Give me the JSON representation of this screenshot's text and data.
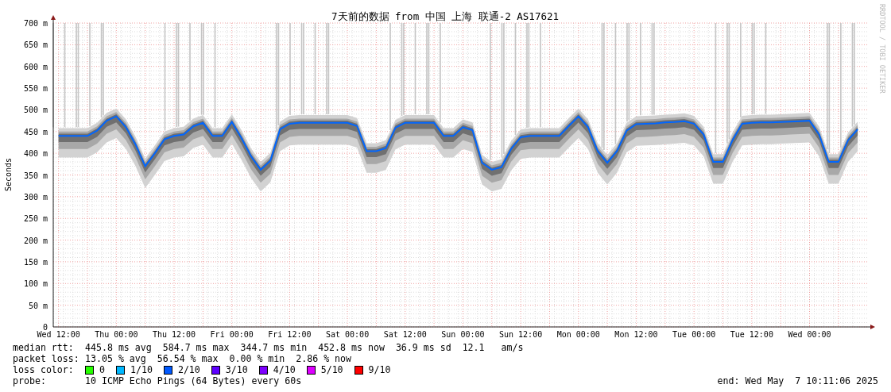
{
  "chart": {
    "credit": "RRDTOOL / TOBI OETIKER",
    "chart_data": {
      "type": "line",
      "grid": true,
      "title": "7天前的数据 from 中国 上海 联通-2 AS17621",
      "ylabel": "Seconds",
      "ylim": [
        0,
        700
      ],
      "yticks": [
        {
          "value": 0,
          "label": "0"
        },
        {
          "value": 50,
          "label": "50 m"
        },
        {
          "value": 100,
          "label": "100 m"
        },
        {
          "value": 150,
          "label": "150 m"
        },
        {
          "value": 200,
          "label": "200 m"
        },
        {
          "value": 250,
          "label": "250 m"
        },
        {
          "value": 300,
          "label": "300 m"
        },
        {
          "value": 350,
          "label": "350 m"
        },
        {
          "value": 400,
          "label": "400 m"
        },
        {
          "value": 450,
          "label": "450 m"
        },
        {
          "value": 500,
          "label": "500 m"
        },
        {
          "value": 550,
          "label": "550 m"
        },
        {
          "value": 600,
          "label": "600 m"
        },
        {
          "value": 650,
          "label": "650 m"
        },
        {
          "value": 700,
          "label": "700 m"
        }
      ],
      "categories": [
        "Wed 12:00",
        null,
        null,
        null,
        null,
        null,
        "Thu 00:00",
        null,
        null,
        null,
        null,
        null,
        "Thu 12:00",
        null,
        null,
        null,
        null,
        null,
        "Fri 00:00",
        null,
        null,
        null,
        null,
        null,
        "Fri 12:00",
        null,
        null,
        null,
        null,
        null,
        "Sat 00:00",
        null,
        null,
        null,
        null,
        null,
        "Sat 12:00",
        null,
        null,
        null,
        null,
        null,
        "Sun 00:00",
        null,
        null,
        null,
        null,
        null,
        "Sun 12:00",
        null,
        null,
        null,
        null,
        null,
        "Mon 00:00",
        null,
        null,
        null,
        null,
        null,
        "Mon 12:00",
        null,
        null,
        null,
        null,
        null,
        "Tue 00:00",
        null,
        null,
        null,
        null,
        null,
        "Tue 12:00",
        null,
        null,
        null,
        null,
        null,
        "Wed 00:00",
        null,
        null,
        null,
        null,
        null
      ],
      "series": [
        {
          "color": "#0066ff",
          "values": [
            440,
            440,
            440,
            440,
            452,
            475,
            485,
            460,
            420,
            370,
            400,
            432,
            440,
            443,
            462,
            470,
            440,
            440,
            472,
            435,
            393,
            362,
            383,
            455,
            468,
            470,
            470,
            470,
            470,
            470,
            470,
            463,
            405,
            405,
            412,
            459,
            470,
            470,
            470,
            470,
            440,
            440,
            460,
            453,
            378,
            362,
            368,
            410,
            437,
            440,
            440,
            440,
            440,
            463,
            485,
            460,
            405,
            378,
            405,
            452,
            467,
            468,
            469,
            471,
            472,
            474,
            468,
            443,
            380,
            380,
            430,
            468,
            470,
            471,
            471,
            472,
            473,
            474,
            475,
            443,
            380,
            380,
            430,
            455
          ]
        }
      ]
    }
  },
  "stats": [
    {
      "label": "median rtt:",
      "text": "445.8 ms avg  584.7 ms max  344.7 ms min  452.8 ms now  36.9 ms sd  12.1   am/s"
    },
    {
      "label": "packet loss:",
      "text": "13.05 % avg  56.54 % max  0.00 % min  2.86 % now"
    }
  ],
  "loss_color": {
    "label": "loss color:",
    "items": [
      {
        "label": "0",
        "color": "#26ff00"
      },
      {
        "label": "1/10",
        "color": "#00b8ff"
      },
      {
        "label": "2/10",
        "color": "#0059ff"
      },
      {
        "label": "3/10",
        "color": "#5e00ff"
      },
      {
        "label": "4/10",
        "color": "#7e00ff"
      },
      {
        "label": "5/10",
        "color": "#dd00ff"
      },
      {
        "label": "9/10",
        "color": "#ff0000"
      }
    ]
  },
  "probe": {
    "label": "probe:",
    "text": "10 ICMP Echo Pings (64 Bytes) every 60s",
    "end": "end: Wed May  7 10:11:06 2025"
  }
}
